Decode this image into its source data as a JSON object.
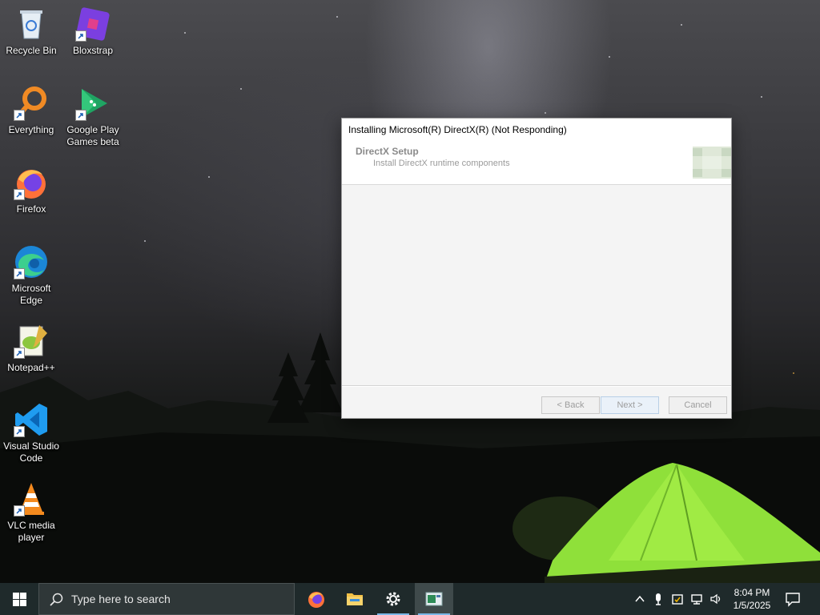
{
  "desktop": {
    "icons": [
      {
        "label_line1": "Recycle Bin",
        "label_line2": "",
        "icon": "recycle-bin-icon"
      },
      {
        "label_line1": "Bloxstrap",
        "label_line2": "",
        "icon": "bloxstrap-icon"
      },
      {
        "label_line1": "Everything",
        "label_line2": "",
        "icon": "everything-search-icon"
      },
      {
        "label_line1": "Google Play",
        "label_line2": "Games beta",
        "icon": "google-play-games-icon"
      },
      {
        "label_line1": "Firefox",
        "label_line2": "",
        "icon": "firefox-icon"
      },
      {
        "label_line1": "Microsoft",
        "label_line2": "Edge",
        "icon": "edge-icon"
      },
      {
        "label_line1": "Notepad++",
        "label_line2": "",
        "icon": "notepad-plus-plus-icon"
      },
      {
        "label_line1": "Visual Studio",
        "label_line2": "Code",
        "icon": "vscode-icon"
      },
      {
        "label_line1": "VLC media",
        "label_line2": "player",
        "icon": "vlc-icon"
      }
    ]
  },
  "dialog": {
    "title": "Installing Microsoft(R) DirectX(R) (Not Responding)",
    "header_title": "DirectX Setup",
    "header_subtitle": "Install DirectX runtime components",
    "back_label": "< Back",
    "next_label": "Next >",
    "cancel_label": "Cancel"
  },
  "taskbar": {
    "search_placeholder": "Type here to search",
    "apps": [
      "firefox-icon",
      "file-explorer-icon",
      "settings-gear-icon",
      "directx-setup-icon"
    ],
    "time": "8:04 PM",
    "date": "1/5/2025"
  },
  "colors": {
    "taskbar_bg": "#1f2a2b",
    "accent": "#7ab8e8",
    "tent_green": "#8fe03a"
  }
}
